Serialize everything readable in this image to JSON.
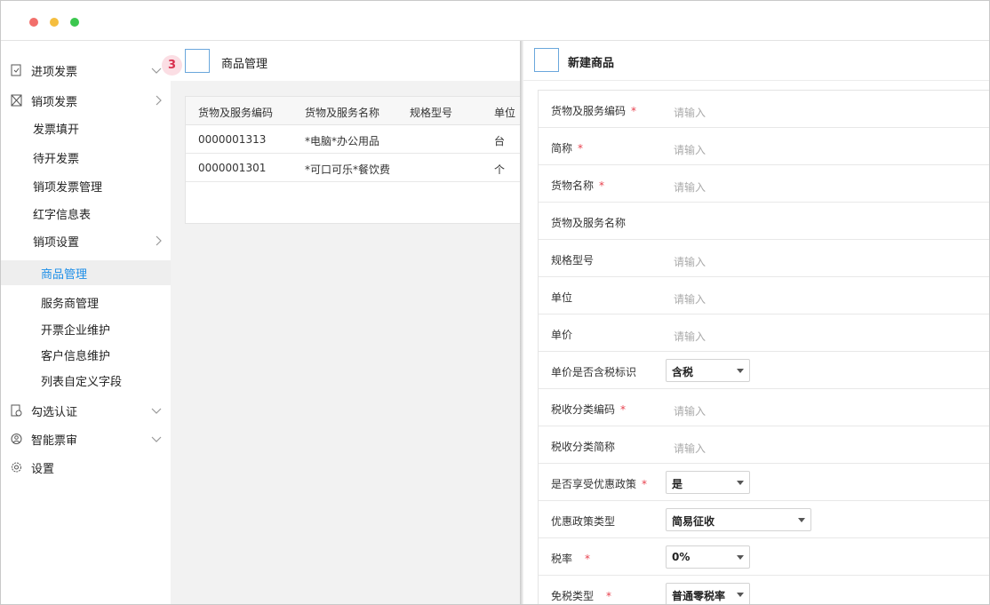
{
  "sidebar": {
    "items": [
      {
        "label": "进项发票",
        "icon": "invoice-in-icon"
      },
      {
        "label": "销项发票",
        "icon": "invoice-out-icon"
      },
      {
        "label": "发票填开"
      },
      {
        "label": "待开发票"
      },
      {
        "label": "销项发票管理"
      },
      {
        "label": "红字信息表"
      },
      {
        "label": "销项设置"
      },
      {
        "label": "商品管理"
      },
      {
        "label": "服务商管理"
      },
      {
        "label": "开票企业维护"
      },
      {
        "label": "客户信息维护"
      },
      {
        "label": "列表自定义字段"
      },
      {
        "label": "勾选认证",
        "icon": "certify-icon"
      },
      {
        "label": "智能票审",
        "icon": "user-check-icon"
      },
      {
        "label": "设置",
        "icon": "gear-icon"
      }
    ],
    "badge": "3",
    "active_color": "#1e8fe8"
  },
  "main": {
    "title": "商品管理",
    "table": {
      "headers": [
        "货物及服务编码",
        "货物及服务名称",
        "规格型号",
        "单位"
      ],
      "rows": [
        [
          "0000001313",
          "*电脑*办公用品",
          "",
          "台"
        ],
        [
          "0000001301",
          "*可口可乐*餐饮费",
          "",
          "个"
        ]
      ]
    }
  },
  "panel": {
    "title": "新建商品",
    "fields": [
      {
        "label": "货物及服务编码",
        "required": "*",
        "placeholder": "请输入"
      },
      {
        "label": "简称",
        "required": "*",
        "placeholder": "请输入"
      },
      {
        "label": "货物名称",
        "required": "*",
        "placeholder": "请输入"
      },
      {
        "label": "货物及服务名称",
        "required": "",
        "placeholder": ""
      },
      {
        "label": "规格型号",
        "required": "",
        "placeholder": "请输入"
      },
      {
        "label": "单位",
        "required": "",
        "placeholder": "请输入"
      },
      {
        "label": "单价",
        "required": "",
        "placeholder": "请输入"
      },
      {
        "label": "单价是否含税标识",
        "required": "",
        "select": "含税"
      },
      {
        "label": "税收分类编码",
        "required": "*",
        "placeholder": "请输入"
      },
      {
        "label": "税收分类简称",
        "required": "",
        "placeholder": "请输入"
      },
      {
        "label": "是否享受优惠政策",
        "required": "*",
        "select": "是"
      },
      {
        "label": "优惠政策类型",
        "required": "",
        "select": "简易征收"
      },
      {
        "label": "税率",
        "required": "*",
        "select": "0%"
      },
      {
        "label": "免税类型",
        "required": "*",
        "select": "普通零税率"
      }
    ],
    "required_color": "#e8424f"
  }
}
